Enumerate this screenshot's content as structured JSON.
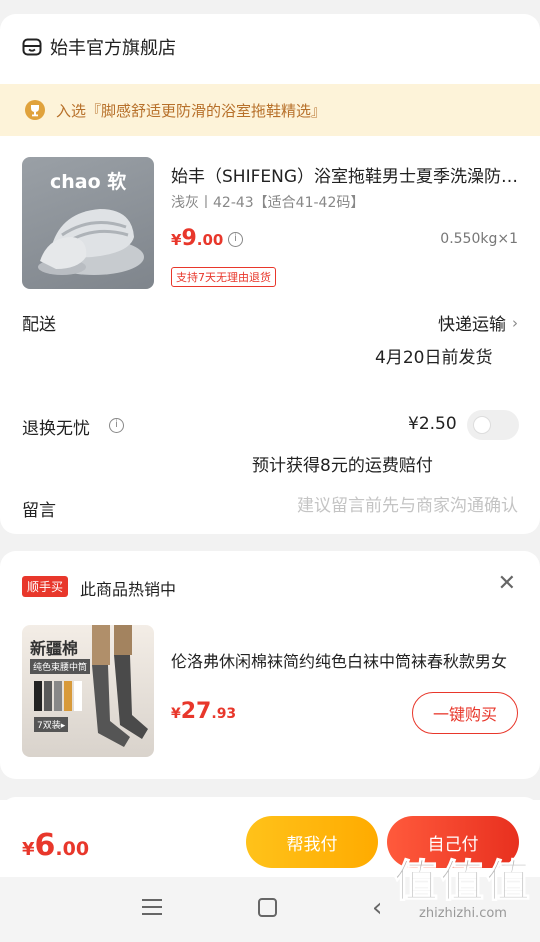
{
  "store": {
    "name": "始丰官方旗舰店",
    "icon": "store-icon"
  },
  "award": {
    "text": "入选『脚感舒适更防滑的浴室拖鞋精选』",
    "icon": "trophy-icon"
  },
  "product": {
    "image_label": "chao 软",
    "title": "始丰（SHIFENG）浴室拖鞋男士夏季洗澡防滑家居拖鞋",
    "spec": "浅灰丨42-43【适合41-42码】",
    "price_currency": "¥",
    "price_int": "9",
    "price_dec": ".00",
    "weight_qty": "0.550kg×1",
    "return_badge": "支持7天无理由退货"
  },
  "shipping": {
    "label": "配送",
    "value": "快递运输",
    "date": "4月20日前发货"
  },
  "return_insurance": {
    "label": "退换无忧",
    "price": "¥2.50",
    "toggle_on": false,
    "compensation": "预计获得8元的运费赔付"
  },
  "note": {
    "label": "留言",
    "placeholder": "建议留言前先与商家沟通确认"
  },
  "recommend": {
    "tag": "顺手买",
    "heading": "此商品热销中",
    "image_title": "新疆棉",
    "image_sub": "纯色束腰中筒",
    "image_pack": "7双装▸",
    "title": "伦洛弗休闲棉袜简约纯色白袜中筒袜春秋款男女",
    "price_currency": "¥",
    "price_int": "27",
    "price_dec": ".93",
    "buy_label": "一键购买"
  },
  "paybar": {
    "total_currency": "¥",
    "total_int": "6",
    "total_dec": ".00",
    "help_pay_label": "帮我付",
    "self_pay_label": "自己付"
  },
  "watermark": {
    "big": "值值值",
    "small": "zhizhizhi.com"
  },
  "colors": {
    "accent": "#e8372b",
    "help_button": "#ffb300",
    "banner_bg": "#fdf3d9"
  }
}
